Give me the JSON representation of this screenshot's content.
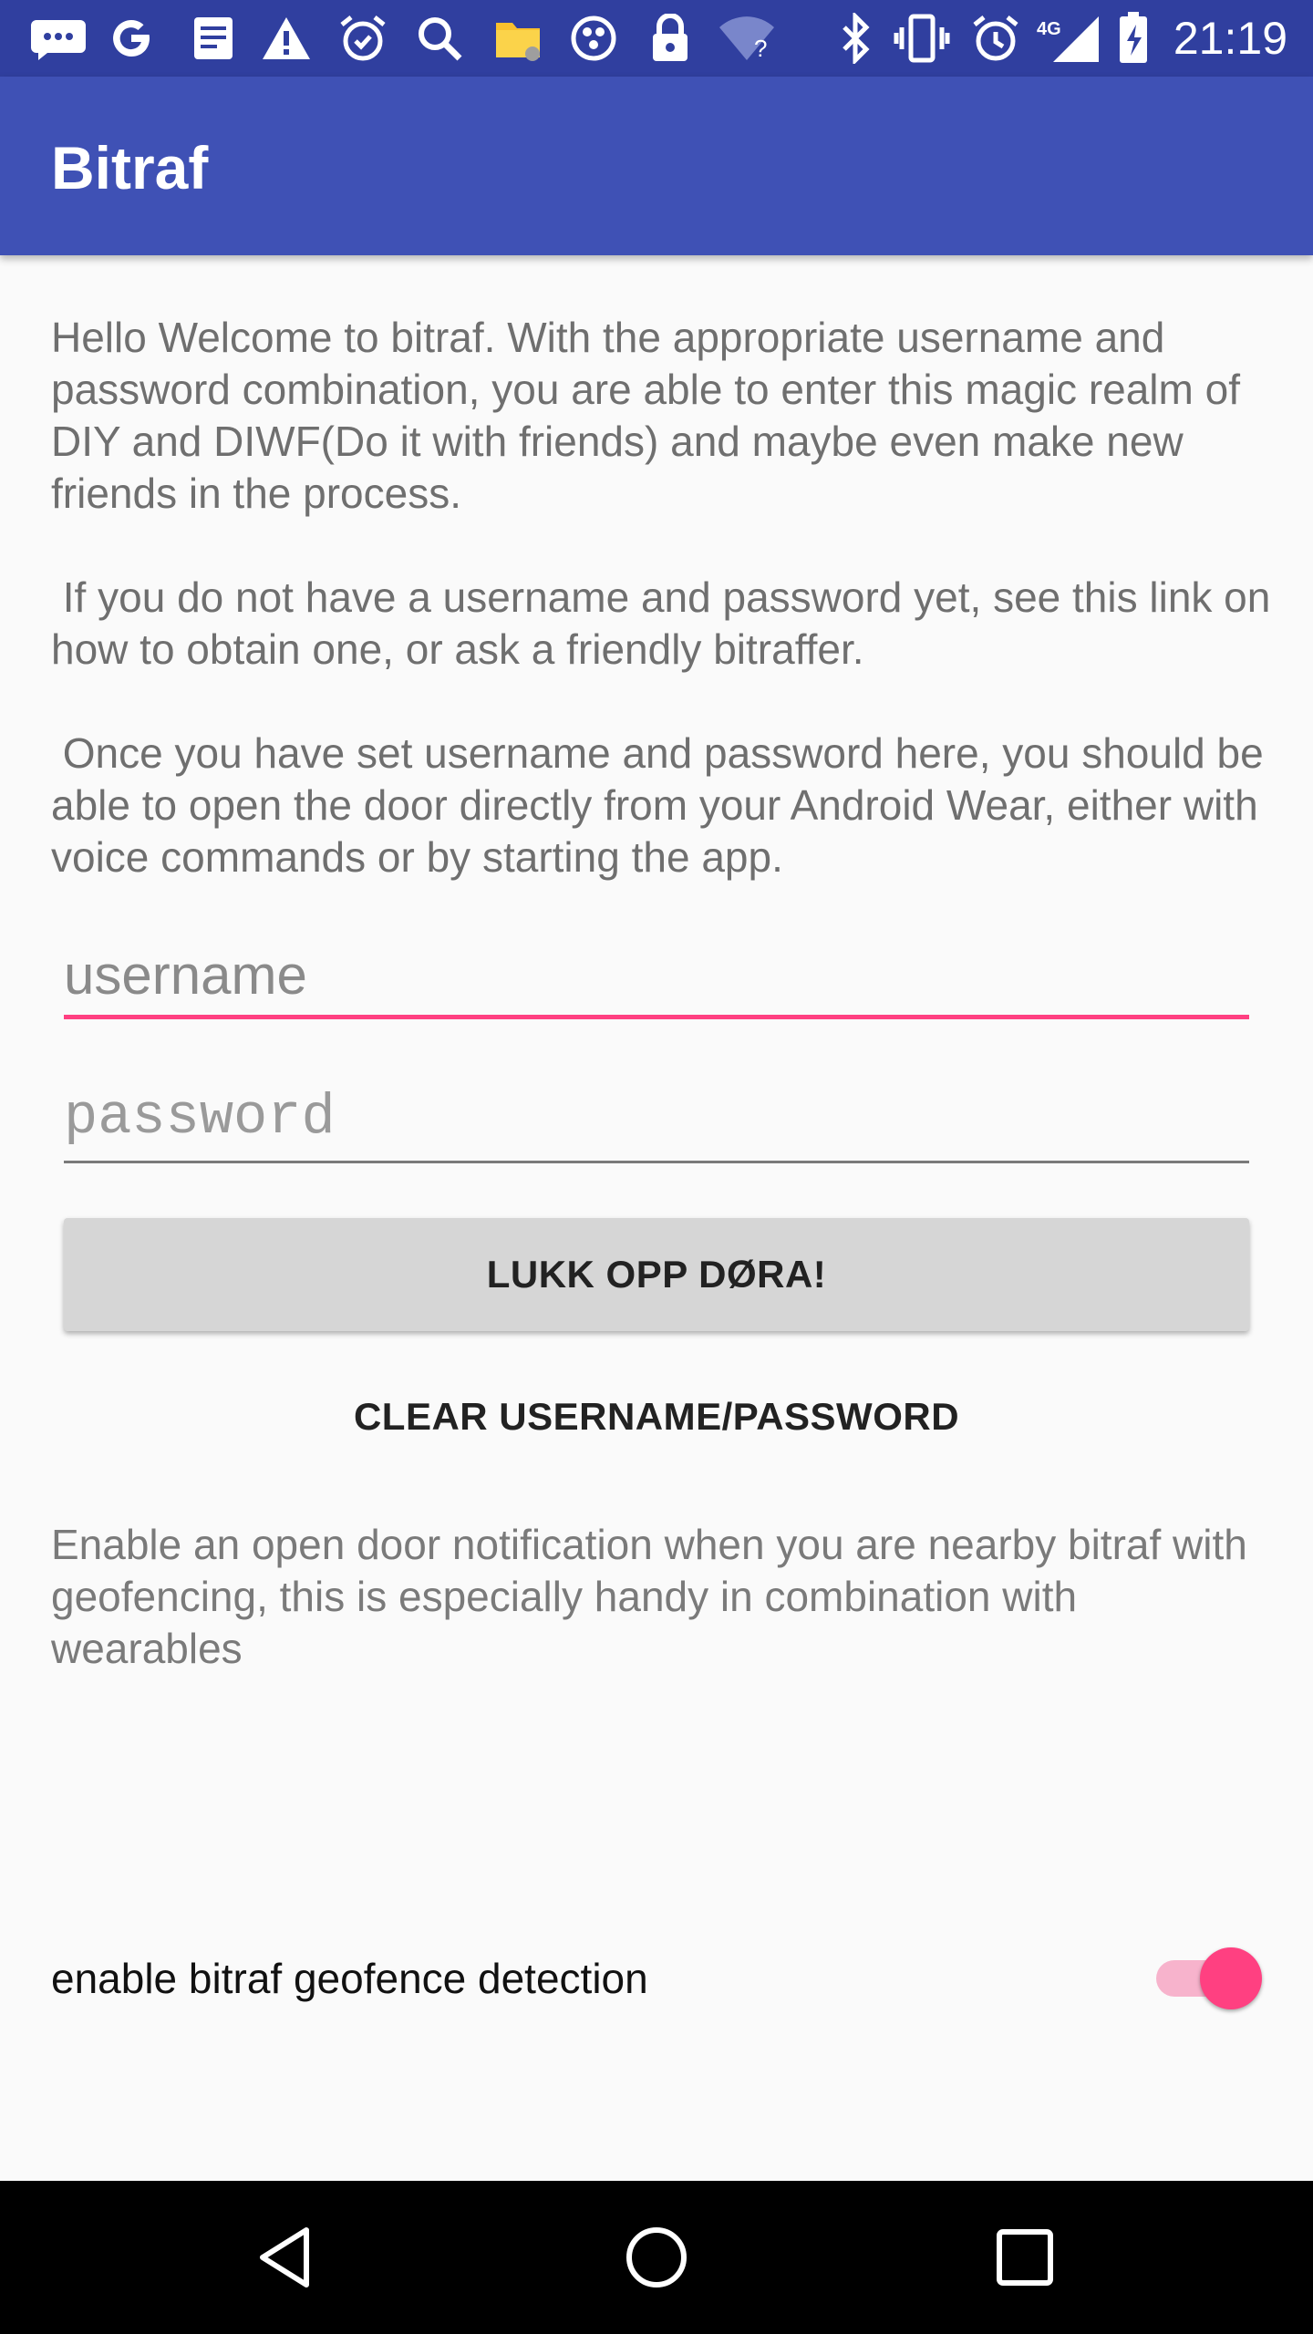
{
  "status_bar": {
    "time": "21:19",
    "network_label": "4G",
    "icons": [
      "messages-icon",
      "google-icon",
      "news-icon",
      "warning-icon",
      "alarm-icon",
      "search-icon",
      "files-icon",
      "game-icon",
      "lock-icon",
      "wifi-unknown-icon",
      "bluetooth-icon",
      "vibrate-icon",
      "alarm-clock-icon",
      "signal-icon",
      "battery-charging-icon"
    ]
  },
  "app_bar": {
    "title": "Bitraf"
  },
  "intro": {
    "paragraph1": "Hello Welcome to bitraf. With the appropriate username and password combination, you are able to enter this magic realm of DIY and DIWF(Do it with friends) and maybe even make new friends in the process.",
    "paragraph2": " If you do not have a username and password yet, see this link on how to obtain one, or ask a friendly bitraffer.",
    "paragraph3": " Once you have set username and password here, you should be able to open the door directly from your Android Wear, either with voice commands or by starting the app."
  },
  "form": {
    "username_placeholder": "username",
    "username_value": "",
    "password_placeholder": "password",
    "password_value": "",
    "unlock_label": "LUKK OPP DØRA!",
    "clear_label": "CLEAR USERNAME/PASSWORD"
  },
  "geofence": {
    "description": "Enable an open door notification when you are nearby bitraf with geofencing, this is especially handy in combination with wearables",
    "toggle_label": "enable bitraf geofence detection",
    "enabled": true
  },
  "colors": {
    "status_bar": "#303f9f",
    "app_bar": "#3f51b5",
    "accent": "#ff4081"
  }
}
